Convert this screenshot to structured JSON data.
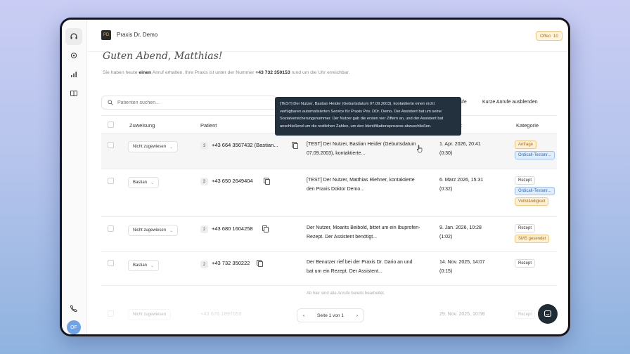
{
  "header": {
    "logo_text": "PD",
    "practice_name": "Praxis Dr. Demo",
    "open_label": "Offen",
    "open_count": "10"
  },
  "rail": {
    "icons": [
      "headset-icon",
      "gear-icon",
      "chart-icon",
      "book-icon",
      "phone-icon"
    ],
    "avatar_initials": "OF"
  },
  "greeting": "Guten Abend, Matthias!",
  "subtitle": {
    "p1": "Sie haben heute",
    "count": "einen",
    "p2": "Anruf erhalten. Ihre Praxis ist unter der Nummer",
    "number": "+43 732 350153",
    "p3": "rund um die Uhr erreichbar."
  },
  "search": {
    "placeholder": "Patienten suchen..."
  },
  "toolbar": {
    "partial_link": "ufe",
    "hide_short": "Kurze Anrufe ausblenden"
  },
  "table": {
    "columns": {
      "assignment": "Zuweisung",
      "patient": "Patient",
      "time": "kt",
      "category": "Kategorie"
    },
    "rows": [
      {
        "assignment": "Nicht zugewiesen",
        "count": "3",
        "phone": "+43 664 3567432 (Bastian...",
        "summary": "[TEST] Der Nutzer, Bastian Heider (Geburtsdatum 07.09.2003), kontaktierte...",
        "date": "1. Apr. 2026, 20:41",
        "duration": "(0:30)",
        "tags": [
          {
            "label": "Anfrage",
            "style": "orange"
          },
          {
            "label": "Ordicall-Testanr...",
            "style": "blue"
          }
        ]
      },
      {
        "assignment": "Bastian",
        "count": "3",
        "phone": "+43 650 2649404",
        "summary": "[TEST] Der Nutzer, Matthias Riehner, kontaktierte den Praxis Doktor Demo...",
        "date": "6. März 2026, 15:31",
        "duration": "(0:32)",
        "tags": [
          {
            "label": "Rezept",
            "style": "neutral"
          },
          {
            "label": "Ordicall-Testanr...",
            "style": "blue"
          },
          {
            "label": "Vollständigkeit",
            "style": "orange"
          }
        ]
      },
      {
        "assignment": "Nicht zugewiesen",
        "count": "2",
        "phone": "+43 680 1604258",
        "summary": "Der Nutzer, Moarits Beibold, bittet um ein Ibuprofen-Rezept. Der Assistent benötigt...",
        "date": "9. Jan. 2026, 10:28",
        "duration": "(1:02)",
        "tags": [
          {
            "label": "Rezept",
            "style": "neutral"
          },
          {
            "label": "SMS gesendet",
            "style": "orange"
          }
        ]
      },
      {
        "assignment": "Bastian",
        "count": "2",
        "phone": "+43 732 350222",
        "summary": "Der Benutzer rief bei der Praxis Dr. Dario an und bat um ein Rezept. Der Assistent...",
        "date": "14. Nov. 2025, 14:07",
        "duration": "(0:15)",
        "tags": [
          {
            "label": "Rezept",
            "style": "neutral"
          }
        ]
      }
    ],
    "done_message": "Ab hier sind alle Anrufe bereits bearbeitet.",
    "faded_row": {
      "assignment": "Nicht zugewiesen",
      "phone": "+43 676 1897653",
      "date": "29. Nov. 2025, 10:58",
      "tag": "Rezept"
    }
  },
  "pagination": {
    "label": "Seite 1 von 1",
    "prev": "‹",
    "next": "›"
  },
  "tooltip": {
    "text": "[TEST] Der Nutzer, Bastian Heider (Geburtsdatum 07.09.2003), kontaktierte einen nicht verfügbaren automatisierten Service für Praxis Priv. DDr. Demo. Der Assistent bat um seine Sozialversicherungsnummer. Der Nutzer gab die ersten vier Ziffern an, und der Assistent bat anschließend um die restlichen Zahlen, um den Identifikationsprozess abzuschließen."
  },
  "colors": {
    "tag_orange": "#fdf0d8",
    "tag_blue": "#e2edfb",
    "tooltip_bg": "#23313f",
    "fab_bg": "#1f2b35",
    "avatar_bg": "#6fa3e6"
  }
}
